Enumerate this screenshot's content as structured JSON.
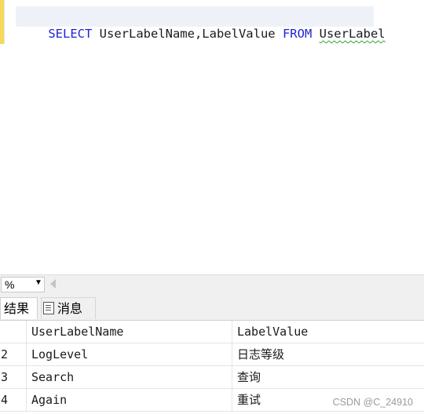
{
  "editor": {
    "query_tokens": [
      {
        "text": "SELECT",
        "kind": "keyword"
      },
      {
        "text": " UserLabelName,LabelValue ",
        "kind": "plain"
      },
      {
        "text": "FROM",
        "kind": "keyword"
      },
      {
        "text": " ",
        "kind": "plain"
      },
      {
        "text": "UserLabel",
        "kind": "squiggle"
      }
    ],
    "keyword_color": "#1f1fd6",
    "change_bar_color": "#f5d95a"
  },
  "zoom": {
    "value": "%",
    "dropdown_icon": "chevron-down-icon",
    "scroll_icon": "scroll-left-icon"
  },
  "tabs": {
    "results_label": "结果",
    "messages_label": "消息",
    "messages_icon": "message-icon"
  },
  "grid": {
    "headers": [
      "",
      "UserLabelName",
      "LabelValue"
    ],
    "rows": [
      {
        "num": "2",
        "name": "LogLevel",
        "value": "日志等级"
      },
      {
        "num": "3",
        "name": "Search",
        "value": "查询"
      },
      {
        "num": "4",
        "name": "Again",
        "value": "重试"
      }
    ]
  },
  "watermark": "CSDN @C_24910"
}
